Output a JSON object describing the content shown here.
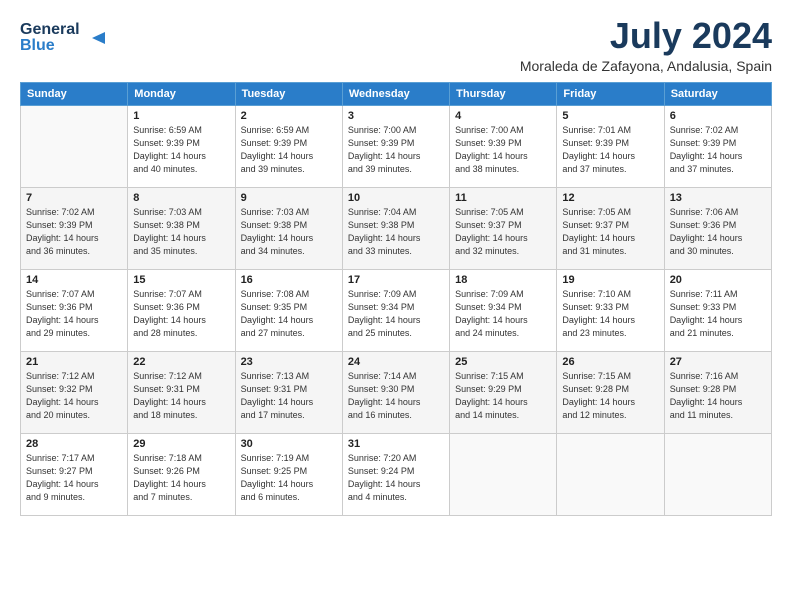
{
  "header": {
    "logo_line1": "General",
    "logo_line2": "Blue",
    "title": "July 2024",
    "subtitle": "Moraleda de Zafayona, Andalusia, Spain"
  },
  "days_of_week": [
    "Sunday",
    "Monday",
    "Tuesday",
    "Wednesday",
    "Thursday",
    "Friday",
    "Saturday"
  ],
  "weeks": [
    [
      {
        "day": "",
        "info": ""
      },
      {
        "day": "1",
        "info": "Sunrise: 6:59 AM\nSunset: 9:39 PM\nDaylight: 14 hours\nand 40 minutes."
      },
      {
        "day": "2",
        "info": "Sunrise: 6:59 AM\nSunset: 9:39 PM\nDaylight: 14 hours\nand 39 minutes."
      },
      {
        "day": "3",
        "info": "Sunrise: 7:00 AM\nSunset: 9:39 PM\nDaylight: 14 hours\nand 39 minutes."
      },
      {
        "day": "4",
        "info": "Sunrise: 7:00 AM\nSunset: 9:39 PM\nDaylight: 14 hours\nand 38 minutes."
      },
      {
        "day": "5",
        "info": "Sunrise: 7:01 AM\nSunset: 9:39 PM\nDaylight: 14 hours\nand 37 minutes."
      },
      {
        "day": "6",
        "info": "Sunrise: 7:02 AM\nSunset: 9:39 PM\nDaylight: 14 hours\nand 37 minutes."
      }
    ],
    [
      {
        "day": "7",
        "info": "Sunrise: 7:02 AM\nSunset: 9:39 PM\nDaylight: 14 hours\nand 36 minutes."
      },
      {
        "day": "8",
        "info": "Sunrise: 7:03 AM\nSunset: 9:38 PM\nDaylight: 14 hours\nand 35 minutes."
      },
      {
        "day": "9",
        "info": "Sunrise: 7:03 AM\nSunset: 9:38 PM\nDaylight: 14 hours\nand 34 minutes."
      },
      {
        "day": "10",
        "info": "Sunrise: 7:04 AM\nSunset: 9:38 PM\nDaylight: 14 hours\nand 33 minutes."
      },
      {
        "day": "11",
        "info": "Sunrise: 7:05 AM\nSunset: 9:37 PM\nDaylight: 14 hours\nand 32 minutes."
      },
      {
        "day": "12",
        "info": "Sunrise: 7:05 AM\nSunset: 9:37 PM\nDaylight: 14 hours\nand 31 minutes."
      },
      {
        "day": "13",
        "info": "Sunrise: 7:06 AM\nSunset: 9:36 PM\nDaylight: 14 hours\nand 30 minutes."
      }
    ],
    [
      {
        "day": "14",
        "info": "Sunrise: 7:07 AM\nSunset: 9:36 PM\nDaylight: 14 hours\nand 29 minutes."
      },
      {
        "day": "15",
        "info": "Sunrise: 7:07 AM\nSunset: 9:36 PM\nDaylight: 14 hours\nand 28 minutes."
      },
      {
        "day": "16",
        "info": "Sunrise: 7:08 AM\nSunset: 9:35 PM\nDaylight: 14 hours\nand 27 minutes."
      },
      {
        "day": "17",
        "info": "Sunrise: 7:09 AM\nSunset: 9:34 PM\nDaylight: 14 hours\nand 25 minutes."
      },
      {
        "day": "18",
        "info": "Sunrise: 7:09 AM\nSunset: 9:34 PM\nDaylight: 14 hours\nand 24 minutes."
      },
      {
        "day": "19",
        "info": "Sunrise: 7:10 AM\nSunset: 9:33 PM\nDaylight: 14 hours\nand 23 minutes."
      },
      {
        "day": "20",
        "info": "Sunrise: 7:11 AM\nSunset: 9:33 PM\nDaylight: 14 hours\nand 21 minutes."
      }
    ],
    [
      {
        "day": "21",
        "info": "Sunrise: 7:12 AM\nSunset: 9:32 PM\nDaylight: 14 hours\nand 20 minutes."
      },
      {
        "day": "22",
        "info": "Sunrise: 7:12 AM\nSunset: 9:31 PM\nDaylight: 14 hours\nand 18 minutes."
      },
      {
        "day": "23",
        "info": "Sunrise: 7:13 AM\nSunset: 9:31 PM\nDaylight: 14 hours\nand 17 minutes."
      },
      {
        "day": "24",
        "info": "Sunrise: 7:14 AM\nSunset: 9:30 PM\nDaylight: 14 hours\nand 16 minutes."
      },
      {
        "day": "25",
        "info": "Sunrise: 7:15 AM\nSunset: 9:29 PM\nDaylight: 14 hours\nand 14 minutes."
      },
      {
        "day": "26",
        "info": "Sunrise: 7:15 AM\nSunset: 9:28 PM\nDaylight: 14 hours\nand 12 minutes."
      },
      {
        "day": "27",
        "info": "Sunrise: 7:16 AM\nSunset: 9:28 PM\nDaylight: 14 hours\nand 11 minutes."
      }
    ],
    [
      {
        "day": "28",
        "info": "Sunrise: 7:17 AM\nSunset: 9:27 PM\nDaylight: 14 hours\nand 9 minutes."
      },
      {
        "day": "29",
        "info": "Sunrise: 7:18 AM\nSunset: 9:26 PM\nDaylight: 14 hours\nand 7 minutes."
      },
      {
        "day": "30",
        "info": "Sunrise: 7:19 AM\nSunset: 9:25 PM\nDaylight: 14 hours\nand 6 minutes."
      },
      {
        "day": "31",
        "info": "Sunrise: 7:20 AM\nSunset: 9:24 PM\nDaylight: 14 hours\nand 4 minutes."
      },
      {
        "day": "",
        "info": ""
      },
      {
        "day": "",
        "info": ""
      },
      {
        "day": "",
        "info": ""
      }
    ]
  ]
}
